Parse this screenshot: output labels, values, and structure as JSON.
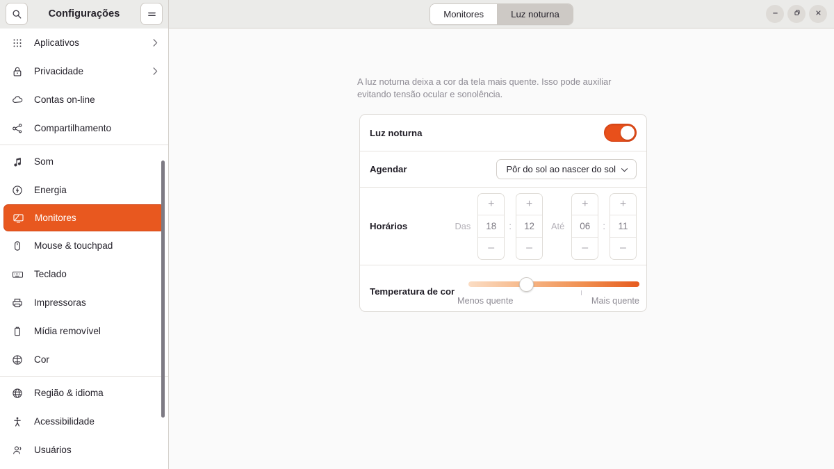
{
  "header": {
    "title": "Configurações",
    "search_icon": "search-icon",
    "menu_icon": "hamburger-menu-icon",
    "tabs": [
      {
        "label": "Monitores",
        "active": false
      },
      {
        "label": "Luz noturna",
        "active": true
      }
    ],
    "window_controls": [
      {
        "name": "minimize",
        "glyph": "–"
      },
      {
        "name": "maximize",
        "glyph": "❐"
      },
      {
        "name": "close",
        "glyph": "✕"
      }
    ]
  },
  "sidebar": {
    "items": [
      {
        "label": "Aplicativos",
        "icon": "apps-grid-icon",
        "chevron": true,
        "selected": false
      },
      {
        "label": "Privacidade",
        "icon": "lock-icon",
        "chevron": true,
        "selected": false
      },
      {
        "label": "Contas on-line",
        "icon": "cloud-icon",
        "chevron": false,
        "selected": false
      },
      {
        "label": "Compartilhamento",
        "icon": "share-nodes-icon",
        "chevron": false,
        "selected": false
      },
      {
        "separator": true
      },
      {
        "label": "Som",
        "icon": "music-note-icon",
        "chevron": false,
        "selected": false
      },
      {
        "label": "Energia",
        "icon": "power-bolt-icon",
        "chevron": false,
        "selected": false
      },
      {
        "label": "Monitores",
        "icon": "display-icon",
        "chevron": false,
        "selected": true
      },
      {
        "label": "Mouse & touchpad",
        "icon": "mouse-icon",
        "chevron": false,
        "selected": false
      },
      {
        "label": "Teclado",
        "icon": "keyboard-icon",
        "chevron": false,
        "selected": false
      },
      {
        "label": "Impressoras",
        "icon": "printer-icon",
        "chevron": false,
        "selected": false
      },
      {
        "label": "Mídia removível",
        "icon": "removable-media-icon",
        "chevron": false,
        "selected": false
      },
      {
        "label": "Cor",
        "icon": "color-wheel-icon",
        "chevron": false,
        "selected": false
      },
      {
        "separator": true
      },
      {
        "label": "Região & idioma",
        "icon": "globe-icon",
        "chevron": false,
        "selected": false
      },
      {
        "label": "Acessibilidade",
        "icon": "accessibility-icon",
        "chevron": false,
        "selected": false
      },
      {
        "label": "Usuários",
        "icon": "users-icon",
        "chevron": false,
        "selected": false
      }
    ]
  },
  "content": {
    "description": "A luz noturna deixa a cor da tela mais quente. Isso pode auxiliar evitando tensão ocular e sonolência.",
    "night_light": {
      "label": "Luz noturna",
      "enabled": true
    },
    "schedule": {
      "label": "Agendar",
      "value": "Pôr do sol ao nascer do sol"
    },
    "times": {
      "label": "Horários",
      "from_label": "Das",
      "to_label": "Até",
      "colon": ":",
      "plus": "+",
      "minus": "–",
      "from_hour": "18",
      "from_minute": "12",
      "to_hour": "06",
      "to_minute": "11"
    },
    "temperature": {
      "label": "Temperatura de cor",
      "min_label": "Menos quente",
      "max_label": "Mais quente",
      "value_percent": 34,
      "tick_percent": 66
    }
  },
  "colors": {
    "accent": "#e8581f",
    "toggle_on": "#e8501b",
    "headerbar": "#ebebe9",
    "content_bg": "#fafafa"
  }
}
